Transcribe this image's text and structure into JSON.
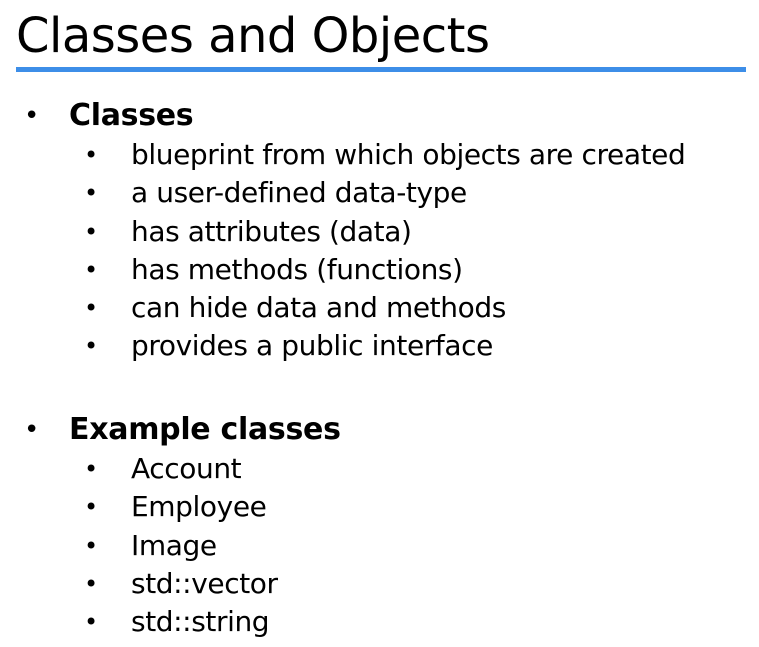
{
  "slide": {
    "title": "Classes and Objects",
    "accent_color": "#3d8ee8",
    "bullet_glyph": "•",
    "sections": [
      {
        "heading": "Classes",
        "items": [
          "blueprint from which objects are created",
          "a user-defined data-type",
          "has attributes (data)",
          "has methods (functions)",
          "can hide data and methods",
          "provides a public interface"
        ]
      },
      {
        "heading": "Example classes",
        "items": [
          "Account",
          "Employee",
          "Image",
          "std::vector",
          "std::string"
        ]
      }
    ]
  }
}
